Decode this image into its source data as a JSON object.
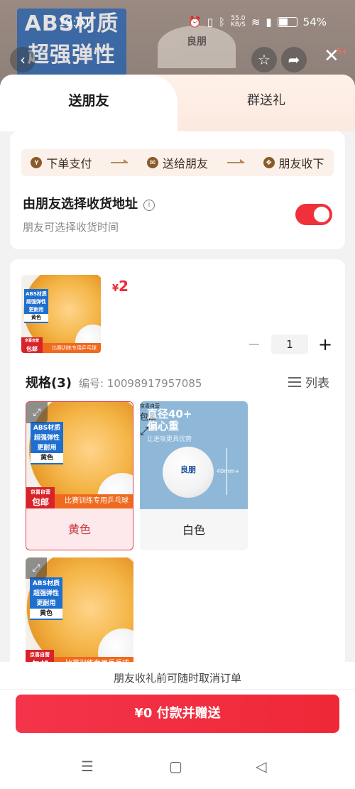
{
  "status_bar": {
    "time": "19:01",
    "net_speed": "55.0",
    "net_unit": "KB/S",
    "battery": "54%"
  },
  "background": {
    "badge_line1": "ABS材质",
    "badge_line2": "超强弹性",
    "logo_text": "良朋",
    "notif_count": "5+"
  },
  "tabs": [
    {
      "label": "送朋友"
    },
    {
      "label": "群送礼"
    }
  ],
  "steps": [
    {
      "label": "下单支付"
    },
    {
      "label": "送给朋友"
    },
    {
      "label": "朋友收下"
    }
  ],
  "address": {
    "title": "由朋友选择收货地址",
    "subtitle": "朋友可选择收货时间",
    "toggle_on": true
  },
  "product": {
    "price_symbol": "¥",
    "price": "2",
    "quantity": "1",
    "image": {
      "box_lines": [
        "ABS材质",
        "超强弹性",
        "更耐用"
      ],
      "color_tag": "黄色",
      "store_tag_top": "京喜自营",
      "store_tag": "包邮",
      "banner": "比赛训练专用乒乓球"
    }
  },
  "spec": {
    "title": "规格(3)",
    "code": "编号: 10098917957085",
    "view_label": "列表"
  },
  "options": [
    {
      "label": "黄色",
      "selected": true
    },
    {
      "label": "白色",
      "selected": false,
      "headline": "直径40+",
      "headline2": "偏心重",
      "sub": "让进攻更具优势",
      "size": "40mm+"
    },
    {
      "label": "",
      "selected": false
    }
  ],
  "footer": {
    "note": "朋友收礼前可随时取消订单",
    "pay_button": "¥0 付款并赠送"
  },
  "colors": {
    "accent": "#ef2837",
    "selected_border": "#d8454f",
    "selected_bg": "#fde9ec"
  }
}
